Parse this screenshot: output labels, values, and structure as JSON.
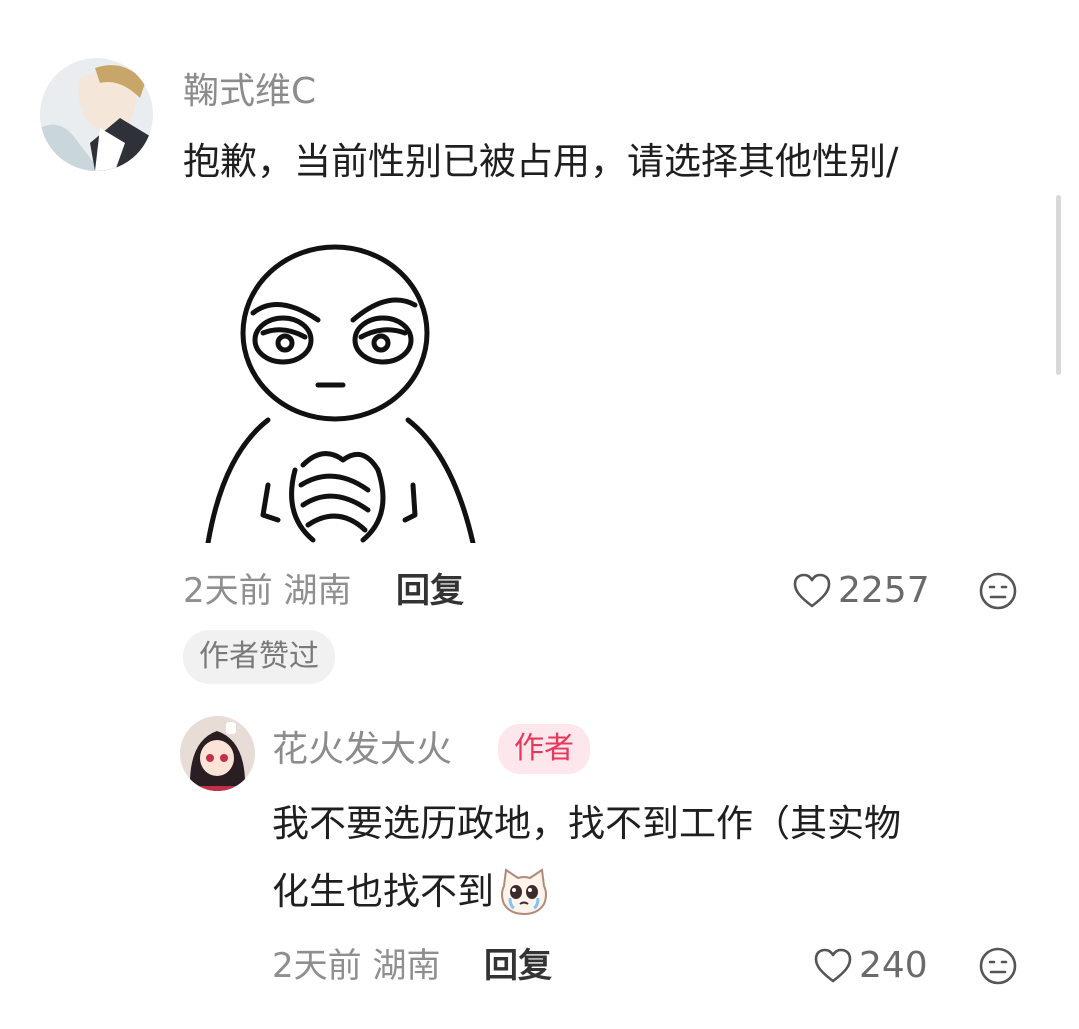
{
  "comments": [
    {
      "username": "鞠式维C",
      "text": "抱歉，当前性别已被占用，请选择其他性别/",
      "meta": "2天前 湖南",
      "reply_label": "回复",
      "likes": "2257",
      "badge": "作者赞过"
    }
  ],
  "reply": {
    "username": "花火发大火",
    "author_badge": "作者",
    "text_line1": "我不要选历政地，找不到工作（其实物",
    "text_line2": "化生也找不到",
    "meta": "2天前 湖南",
    "reply_label": "回复",
    "likes": "240"
  },
  "icons": {
    "like": "heart-outline-icon",
    "dislike": "meh-face-icon",
    "emoji": "crying-cat-emoji"
  },
  "colors": {
    "author_badge_bg": "#fde6ec",
    "author_badge_text": "#e8385a"
  }
}
